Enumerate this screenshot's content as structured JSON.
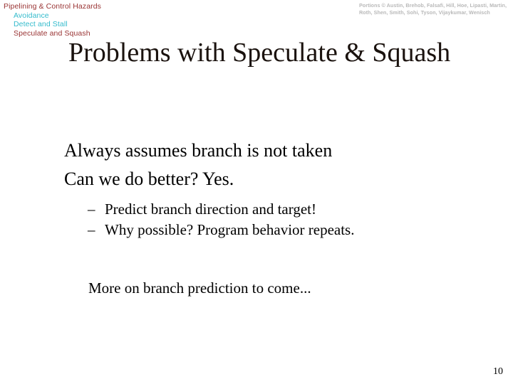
{
  "slide": {
    "background_color": "#ffffff",
    "page_number": "10"
  },
  "outline": {
    "items": [
      {
        "label": "Pipelining & Control Hazards",
        "level": 0,
        "color": "#993333"
      },
      {
        "label": "Avoidance",
        "level": 1,
        "color": "#33bbcc"
      },
      {
        "label": "Detect and Stall",
        "level": 1,
        "color": "#33bbcc"
      },
      {
        "label": "Speculate and Squash",
        "level": 1,
        "color": "#993333"
      }
    ]
  },
  "credits": {
    "line1": "Portions © Austin, Brehob, Falsafi, Hill, Hoe, Lipasti, Martin,",
    "line2": "Roth, Shen, Smith, Sohi, Tyson, Vijaykumar, Wenisch",
    "color": "#b9b9b9"
  },
  "title": {
    "text": "Problems with Speculate & Squash",
    "color": "#1a120e"
  },
  "body": {
    "bullets": [
      {
        "text": "Always assumes branch is not taken"
      },
      {
        "text": "Can we do better?  Yes."
      }
    ],
    "sub_bullets": [
      {
        "marker": "–",
        "text": "Predict branch direction and target!"
      },
      {
        "marker": "–",
        "text": "Why possible? Program behavior repeats."
      }
    ],
    "closing": "More on branch prediction to come..."
  }
}
